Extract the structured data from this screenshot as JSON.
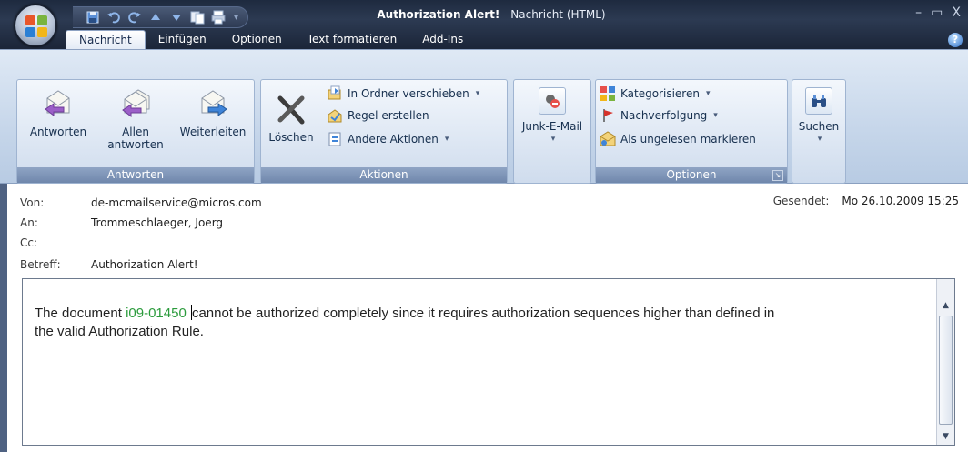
{
  "window": {
    "title_main": "Authorization Alert!",
    "title_suffix": " - Nachricht (HTML)",
    "controls": [
      "minimize-icon",
      "maximize-icon",
      "close-icon"
    ]
  },
  "qat": {
    "icons": [
      "save-icon",
      "undo-icon",
      "redo-icon",
      "up-arrow-icon",
      "down-arrow-icon",
      "copy-icon",
      "print-icon"
    ],
    "more": "▾"
  },
  "tabs": [
    "Nachricht",
    "Einfügen",
    "Optionen",
    "Text formatieren",
    "Add-Ins"
  ],
  "ribbon": {
    "antworten": {
      "label": "Antworten",
      "buttons": [
        "Antworten",
        "Allen",
        "antworten",
        "Weiterleiten"
      ]
    },
    "aktionen": {
      "label": "Aktionen",
      "delete": "Löschen",
      "move": "In Ordner verschieben",
      "rule": "Regel erstellen",
      "other": "Andere Aktionen"
    },
    "junk": {
      "label": "Junk-E-Mail"
    },
    "optionen": {
      "label": "Optionen",
      "categorize": "Kategorisieren",
      "followup": "Nachverfolgung",
      "unread": "Als ungelesen markieren"
    },
    "search": {
      "label": "Suchen"
    }
  },
  "header": {
    "from_label": "Von:",
    "from": "de-mcmailservice@micros.com",
    "to_label": "An:",
    "to": "Trommeschlaeger, Joerg",
    "cc_label": "Cc:",
    "cc": "",
    "subject_label": "Betreff:",
    "subject": "Authorization Alert!",
    "sent_label": "Gesendet:",
    "sent": "Mo 26.10.2009 15:25"
  },
  "message": {
    "prefix": "The document ",
    "doc_id": "i09-01450",
    "line1_rest": "cannot be authorized completely since it requires authorization sequences higher than defined in",
    "line2": "the valid Authorization Rule."
  },
  "colors": {
    "accent": "#2b9b3c",
    "ribbon_label_bg": "#6f87ac",
    "titlebar": "#1e2a3f"
  }
}
